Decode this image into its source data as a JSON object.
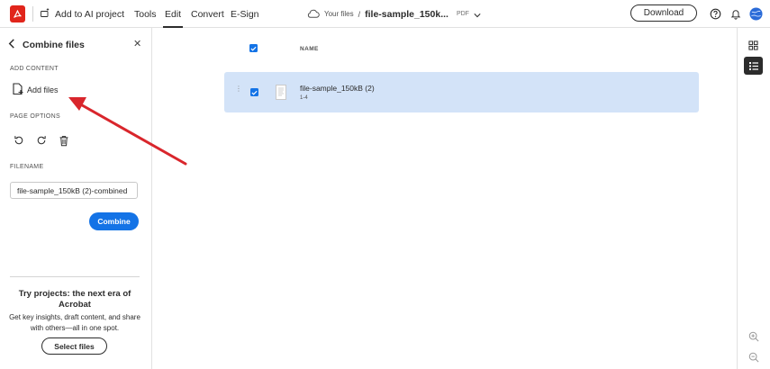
{
  "topbar": {
    "ai_project_label": "Add to AI project",
    "menu": [
      {
        "label": "Tools",
        "active": false
      },
      {
        "label": "Edit",
        "active": true
      },
      {
        "label": "Convert",
        "active": false
      },
      {
        "label": "E-Sign",
        "active": false
      }
    ],
    "breadcrumb": {
      "root": "Your files",
      "separator": "/",
      "file": "file-sample_150k...",
      "type": "PDF"
    },
    "download_label": "Download"
  },
  "left_panel": {
    "title": "Combine files",
    "add_content_label": "ADD CONTENT",
    "add_files_label": "Add files",
    "page_options_label": "PAGE OPTIONS",
    "filename_label": "FILENAME",
    "filename_value": "file-sample_150kB (2)-combined",
    "combine_label": "Combine",
    "promo": {
      "title": "Try projects: the next era of Acrobat",
      "body": "Get key insights, draft content, and share with others—all in one spot.",
      "button_label": "Select files"
    }
  },
  "main": {
    "column_name": "NAME",
    "files": [
      {
        "name": "file-sample_150kB (2)",
        "pages": "1-4",
        "selected": true
      }
    ]
  },
  "colors": {
    "accent": "#1473e6",
    "row_selected": "#d3e3f8",
    "brand_red": "#e1251b",
    "annotation_arrow": "#d9262c"
  }
}
